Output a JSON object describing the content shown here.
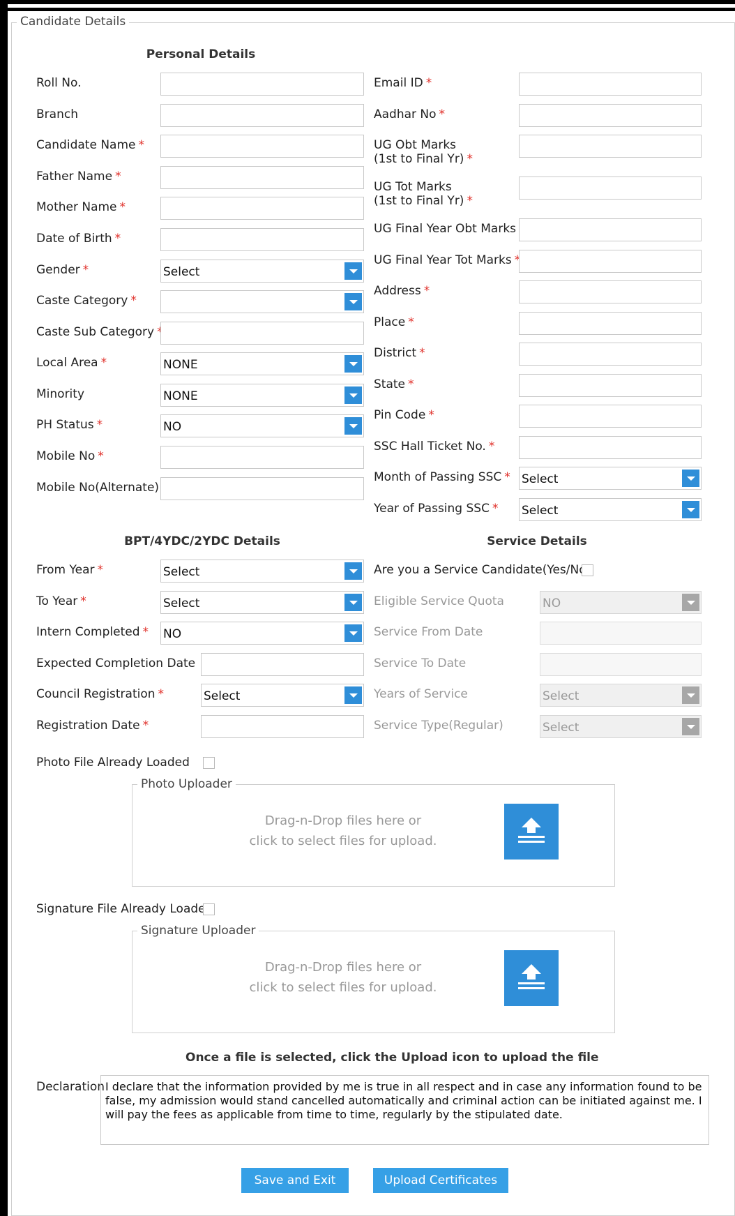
{
  "legend": "Candidate Details",
  "sections": {
    "personal": "Personal Details",
    "bpt": "BPT/4YDC/2YDC Details",
    "service": "Service Details"
  },
  "left_fields": [
    {
      "label": "Roll No.",
      "required": false,
      "type": "text",
      "value": ""
    },
    {
      "label": "Branch",
      "required": false,
      "type": "text",
      "value": ""
    },
    {
      "label": "Candidate Name",
      "required": true,
      "type": "text",
      "value": ""
    },
    {
      "label": "Father Name",
      "required": true,
      "type": "text",
      "value": ""
    },
    {
      "label": "Mother Name",
      "required": true,
      "type": "text",
      "value": ""
    },
    {
      "label": "Date of Birth",
      "required": true,
      "type": "text",
      "value": ""
    },
    {
      "label": "Gender",
      "required": true,
      "type": "select",
      "value": "Select"
    },
    {
      "label": "Caste Category",
      "required": true,
      "type": "select",
      "value": ""
    },
    {
      "label": "Caste Sub Category",
      "required": true,
      "type": "text",
      "value": ""
    },
    {
      "label": "Local Area",
      "required": true,
      "type": "select",
      "value": "NONE"
    },
    {
      "label": "Minority",
      "required": false,
      "type": "select",
      "value": "NONE"
    },
    {
      "label": "PH Status",
      "required": true,
      "type": "select",
      "value": "NO"
    },
    {
      "label": "Mobile No",
      "required": true,
      "type": "text",
      "value": ""
    },
    {
      "label": "Mobile No(Alternate)",
      "required": true,
      "type": "text",
      "value": ""
    }
  ],
  "right_fields": [
    {
      "label": "Email ID",
      "required": true,
      "type": "text",
      "value": ""
    },
    {
      "label": "Aadhar No",
      "required": true,
      "type": "text",
      "value": ""
    },
    {
      "label": "UG Obt Marks",
      "label2": "(1st to Final Yr)",
      "required": true,
      "type": "text",
      "value": ""
    },
    {
      "label": "UG Tot Marks",
      "label2": "(1st to Final Yr)",
      "required": true,
      "type": "text",
      "value": ""
    },
    {
      "label": "UG Final Year Obt Marks",
      "required": true,
      "type": "text",
      "value": ""
    },
    {
      "label": "UG Final Year Tot Marks",
      "required": true,
      "type": "text",
      "value": ""
    },
    {
      "label": "Address",
      "required": true,
      "type": "text",
      "value": ""
    },
    {
      "label": "Place",
      "required": true,
      "type": "text",
      "value": ""
    },
    {
      "label": "District",
      "required": true,
      "type": "text",
      "value": ""
    },
    {
      "label": "State",
      "required": true,
      "type": "text",
      "value": ""
    },
    {
      "label": "Pin Code",
      "required": true,
      "type": "text",
      "value": ""
    },
    {
      "label": "SSC Hall Ticket No.",
      "required": true,
      "type": "text",
      "value": ""
    },
    {
      "label": "Month of Passing SSC",
      "required": true,
      "type": "select",
      "value": "Select"
    },
    {
      "label": "Year of Passing SSC",
      "required": true,
      "type": "select",
      "value": "Select"
    }
  ],
  "bpt_fields": [
    {
      "label": "From Year",
      "required": true,
      "type": "select",
      "value": "Select"
    },
    {
      "label": "To Year",
      "required": true,
      "type": "select",
      "value": "Select"
    },
    {
      "label": "Intern Completed",
      "required": true,
      "type": "select",
      "value": "NO"
    },
    {
      "label": "Expected Completion Date",
      "required": false,
      "type": "text",
      "value": ""
    },
    {
      "label": "Council Registration",
      "required": true,
      "type": "select",
      "value": "Select"
    },
    {
      "label": "Registration Date",
      "required": true,
      "type": "text",
      "value": ""
    }
  ],
  "service_candidate_label": "Are you a Service Candidate(Yes/No)",
  "service_fields": [
    {
      "label": "Eligible Service Quota",
      "type": "select",
      "value": "NO"
    },
    {
      "label": "Service From Date",
      "type": "text",
      "value": ""
    },
    {
      "label": "Service To Date",
      "type": "text",
      "value": ""
    },
    {
      "label": "Years of Service",
      "type": "select",
      "value": "Select"
    },
    {
      "label": "Service Type(Regular)",
      "type": "select",
      "value": "Select"
    }
  ],
  "photo": {
    "loaded_label": "Photo File Already Loaded",
    "uploader_legend": "Photo Uploader",
    "drop_line1": "Drag-n-Drop files here or",
    "drop_line2": "click to select files for upload."
  },
  "signature": {
    "loaded_label": "Signature File Already Loaded",
    "uploader_legend": "Signature Uploader",
    "drop_line1": "Drag-n-Drop files here or",
    "drop_line2": "click to select files for upload."
  },
  "upload_note": "Once a file is selected, click the Upload icon to upload the file",
  "declaration": {
    "label": "Declaration",
    "text": "I declare that the information provided by me is true in all respect and in case any information found to be false, my admission would stand cancelled automatically and criminal action can be initiated against me. I will pay the fees as applicable from time to time, regularly by the stipulated date."
  },
  "buttons": {
    "save_exit": "Save and Exit",
    "upload_certificates": "Upload Certificates"
  },
  "colors": {
    "accent": "#2f8ed8",
    "button": "#36a0e6",
    "required": "#e0302a"
  },
  "icons": {
    "select_arrow": "chevron-down-icon",
    "upload": "upload-icon"
  }
}
